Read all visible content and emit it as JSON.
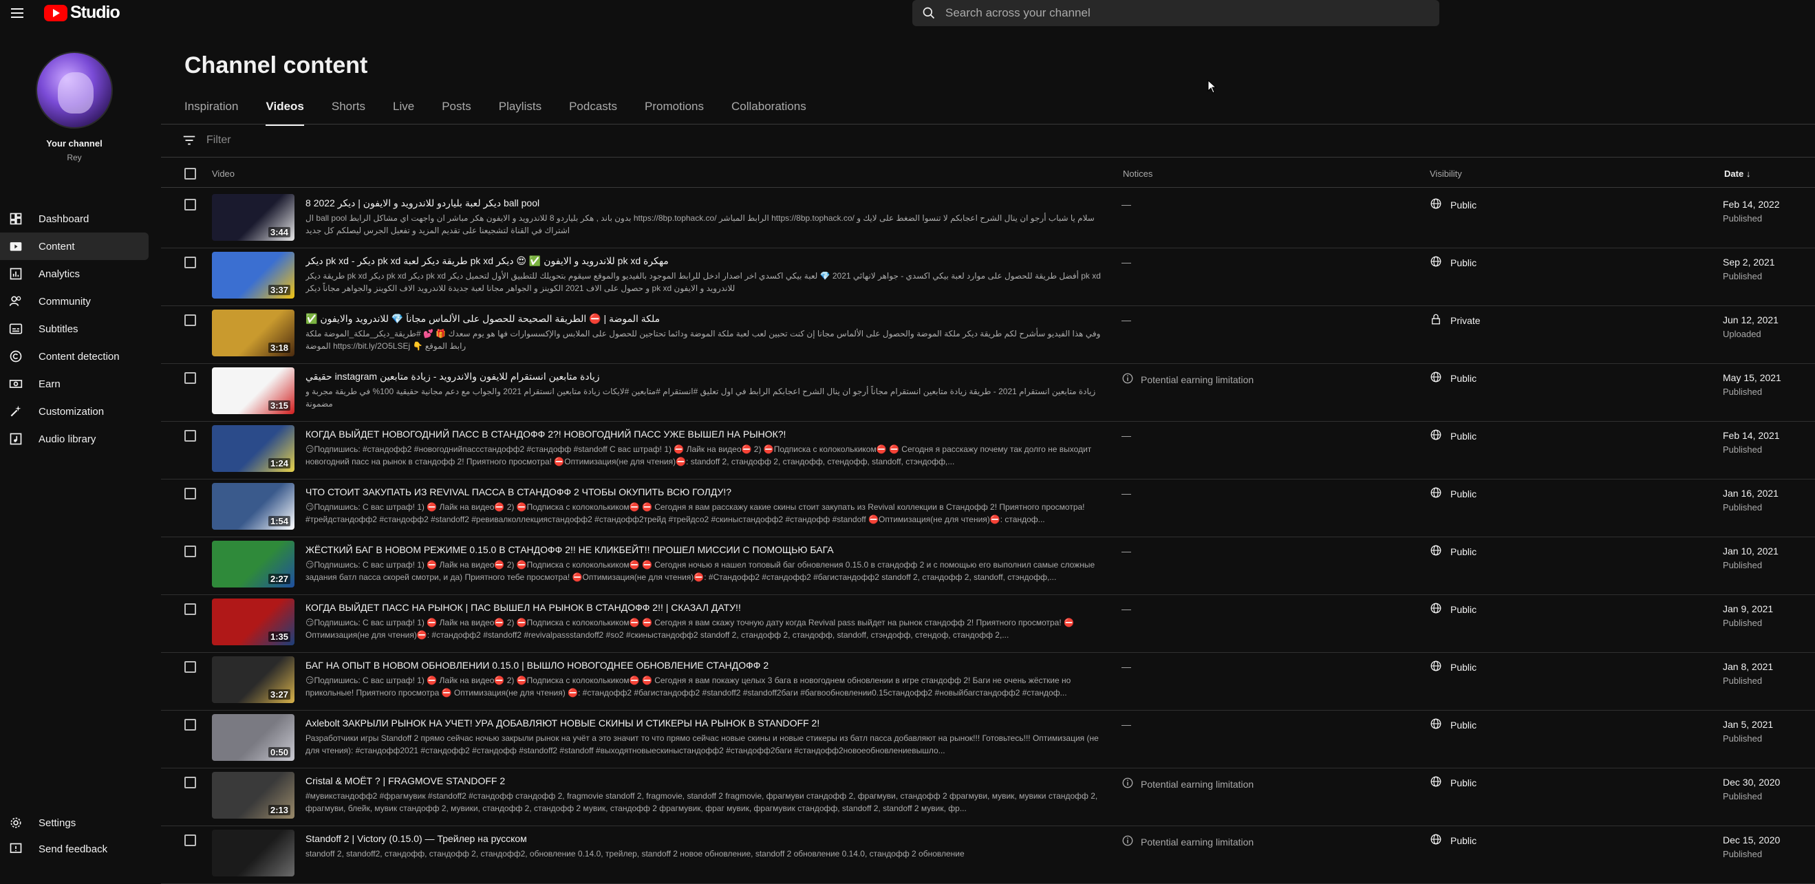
{
  "app": {
    "logo_text": "Studio",
    "search_placeholder": "Search across your channel"
  },
  "sidebar": {
    "channel_label": "Your channel",
    "channel_handle": "Rey",
    "items": [
      {
        "label": "Dashboard",
        "icon": "dashboard-icon"
      },
      {
        "label": "Content",
        "icon": "content-icon",
        "active": true
      },
      {
        "label": "Analytics",
        "icon": "analytics-icon"
      },
      {
        "label": "Community",
        "icon": "community-icon"
      },
      {
        "label": "Subtitles",
        "icon": "subtitles-icon"
      },
      {
        "label": "Content detection",
        "icon": "copyright-icon"
      },
      {
        "label": "Earn",
        "icon": "earn-icon"
      },
      {
        "label": "Customization",
        "icon": "customization-icon"
      },
      {
        "label": "Audio library",
        "icon": "audio-library-icon"
      }
    ],
    "bottom": [
      {
        "label": "Settings",
        "icon": "gear-icon"
      },
      {
        "label": "Send feedback",
        "icon": "feedback-icon"
      }
    ]
  },
  "main": {
    "title": "Channel content",
    "tabs": [
      "Inspiration",
      "Videos",
      "Shorts",
      "Live",
      "Posts",
      "Playlists",
      "Podcasts",
      "Promotions",
      "Collaborations"
    ],
    "active_tab": "Videos",
    "filter_placeholder": "Filter",
    "columns": {
      "video": "Video",
      "notices": "Notices",
      "visibility": "Visibility",
      "date": "Date"
    }
  },
  "colors": {
    "accent": "#ff0000",
    "background": "#0f0f0f",
    "surface": "#282828"
  },
  "videos": [
    {
      "title": "ديكر لعبة بلياردو للاندرويد و الايفون | ديكر 2022 8 ball pool",
      "desc": "ال ball pool بدون باند , هكر بلياردو 8 للاندرويد و الايفون هكر مباشر ان واجهت اي مشاكل الرابط https://8bp.tophack.co/ الرابط المباشر https://8bp.tophack.co/ سلام يا شباب أرجو ان ينال الشرح اعجابكم لا تنسوا الضغط على لايك و اشتراك في القناة لتشجيعنا على تقديم المزيد و تفعيل الجرس ليصلكم كل جديد",
      "duration": "3:44",
      "notice": "—",
      "notice_icon": false,
      "visibility": "Public",
      "vis_icon": "globe",
      "date": "Feb 14, 2022",
      "status": "Published",
      "thumb": [
        "#1a1a2e",
        "#e8e8e8"
      ]
    },
    {
      "title": "ديكر pk xd - ديكر pk xd طريقة ديكر لعبة pk xd للاندرويد و الايفون ✅ 😍 ديكر pk xd مهكرة",
      "desc": "طريقة ديكر pk xd ديكر pk xd ديكر pk xd أفضل طريقة للحصول على موارد لعبة بيكي اكسدي - جواهر لانهائي 2021 💎 لعبة بيكي اكسدي اخر اصدار ادخل للرابط الموجود بالفيديو والموقع سيقوم بتحويلك للتطبيق الأول لتحميل ديكر pk xd و حصول على الاف 2021 الكوينز و الجواهر مجانا لعبة جديدة للاندرويد الاف الكوينز والجواهر مجاناً ديكر pk xd للاندرويد و الايفون",
      "duration": "3:37",
      "notice": "—",
      "notice_icon": false,
      "visibility": "Public",
      "vis_icon": "globe",
      "date": "Sep 2, 2021",
      "status": "Published",
      "thumb": [
        "#3b6fd1",
        "#f2c311"
      ]
    },
    {
      "title": "✅ ملكة الموضة | ⛔ الطريقة الصحيحة للحصول على الألماس مجاناً 💎 للاندرويد والايفون",
      "desc": "وفي هذا الفيديو سأشرح لكم طريقة ديكر ملكة الموضة والحصول على الألماس مجانا إن كنت تحبين لعب لعبة ملكة الموضة ودائما تحتاجين للحصول على الملابس والإكسسوارات فها هو يوم سعدك 🎁 💕 #طريقة_ديكر_ملكة_الموضة ملكة الموضة https://bit.ly/2O5LSEj 👇 رابط الموقع",
      "duration": "3:18",
      "notice": "—",
      "notice_icon": false,
      "visibility": "Private",
      "vis_icon": "lock",
      "date": "Jun 12, 2021",
      "status": "Uploaded",
      "thumb": [
        "#c99a2e",
        "#4a2a0f"
      ]
    },
    {
      "title": "حقيقي instagram زيادة متابعين انستقرام للايفون والاندرويد - زيادة متابعين",
      "desc": "زيادة متابعين انستقرام 2021 - طريقة زيادة متابعين انستقرام مجاناً أرجو ان ينال الشرح اعجابكم الرابط في اول تعليق #انستقرام #متابعين #لايكات زيادة متابعين انستقرام 2021 والجواب مع دعم مجانية حقيقية 100% في طريقة مجربة و مضمونة",
      "duration": "3:15",
      "notice": "Potential earning limitation",
      "notice_icon": true,
      "visibility": "Public",
      "vis_icon": "globe",
      "date": "May 15, 2021",
      "status": "Published",
      "thumb": [
        "#f5f5f5",
        "#d01d1d"
      ]
    },
    {
      "title": "КОГДА ВЫЙДЕТ НОВОГОДНИЙ ПАСС В СТАНДОФФ 2?! НОВОГОДНИЙ ПАСС УЖЕ ВЫШЕЛ НА РЫНОК?!",
      "desc": "😏Подпишись: #стандофф2 #новогоднийпассстандофф2 #стандофф #standoff С вас штраф! 1) ⛔ Лайк на видео⛔ 2) ⛔Подписка с колоколькиком⛔ ⛔ Сегодня я расскажу почему так долго не выходит новогодний пасс на рынок в стандофф 2! Приятного просмотра! ⛔Оптимизация(не для чтения)⛔: standoff 2, стандофф 2, стандофф, стендофф, standoff, стэндофф,...",
      "duration": "1:24",
      "notice": "—",
      "notice_icon": false,
      "visibility": "Public",
      "vis_icon": "globe",
      "date": "Feb 14, 2021",
      "status": "Published",
      "thumb": [
        "#2b4b8a",
        "#e7d24a"
      ]
    },
    {
      "title": "ЧТО СТОИТ ЗАКУПАТЬ ИЗ REVIVAL ПАССА В СТАНДОФФ 2 ЧТОБЫ ОКУПИТЬ ВСЮ ГОЛДУ!?",
      "desc": "😏Подпишись: С вас штраф! 1) ⛔ Лайк на видео⛔ 2) ⛔Подписка с колоколькиком⛔ ⛔ Сегодня я вам расскажу какие скины стоит закупать из Revival коллекции в Стандофф 2! Приятного просмотра! #трейдстандофф2 #стандофф2 #standoff2 #ревивалколлекциястандофф2 #стандофф2трейд #трейдсо2 #скиныстандофф2 #стандофф #standoff ⛔Оптимизация(не для чтения)⛔: стандоф...",
      "duration": "1:54",
      "notice": "—",
      "notice_icon": false,
      "visibility": "Public",
      "vis_icon": "globe",
      "date": "Jan 16, 2021",
      "status": "Published",
      "thumb": [
        "#3a5a8c",
        "#ffffff"
      ]
    },
    {
      "title": "ЖЁСТКИЙ БАГ В НОВОМ РЕЖИМЕ 0.15.0 В СТАНДОФФ 2!! НЕ КЛИКБЕЙТ!! ПРОШЕЛ МИССИИ С ПОМОЩЬЮ БАГА",
      "desc": "😏Подпишись: С вас штраф! 1) ⛔ Лайк на видео⛔ 2) ⛔Подписка с колоколькиком⛔ ⛔ Сегодня ночью я нашел топовый баг обновления 0.15.0 в стандофф 2 и с помощью его выполнил самые сложные задания батл пасса скорей смотри, и да) Приятного тебе просмотра! ⛔Оптимизация(не для чтения)⛔: #Стандофф2 #стандофф2 #багистандофф2 standoff 2, стандофф 2, standoff, стэндофф,...",
      "duration": "2:27",
      "notice": "—",
      "notice_icon": false,
      "visibility": "Public",
      "vis_icon": "globe",
      "date": "Jan 10, 2021",
      "status": "Published",
      "thumb": [
        "#2f8a3a",
        "#1f4fa0"
      ]
    },
    {
      "title": "КОГДА ВЫЙДЕТ ПАСС НА РЫНОК | ПАС ВЫШЕЛ НА РЫНОК В СТАНДОФФ 2!! | СКАЗАЛ ДАТУ!!",
      "desc": "😏Подпишись: С вас штраф! 1) ⛔ Лайк на видео⛔ 2) ⛔Подписка с колоколькиком⛔ ⛔ Сегодня я вам скажу точную дату когда Revival pass выйдет на рынок стандофф 2! Приятного просмотра! ⛔Оптимизация(не для чтения)⛔: #стандофф2 #standoff2 #revivalpassstandoff2 #so2 #скиныстандофф2 standoff 2, стандофф 2, стандофф, standoff, стэндофф, стендоф, стандофф 2,...",
      "duration": "1:35",
      "notice": "—",
      "notice_icon": false,
      "visibility": "Public",
      "vis_icon": "globe",
      "date": "Jan 9, 2021",
      "status": "Published",
      "thumb": [
        "#b01818",
        "#1b3f7a"
      ]
    },
    {
      "title": "БАГ НА ОПЫТ В НОВОМ ОБНОВЛЕНИИ 0.15.0 | ВЫШЛО НОВОГОДНЕЕ ОБНОВЛЕНИЕ СТАНДОФФ 2",
      "desc": "😏Подпишись: С вас штраф! 1) ⛔ Лайк на видео⛔ 2) ⛔Подписка с колоколькиком⛔ ⛔ Сегодня я вам покажу целых 3 бага в новогоднем обновлении в игре стандофф 2! Баги не очень жёсткие но прикольные! Приятного просмотра ⛔ Оптимизация(не для чтения) ⛔: #стандофф2 #багистандофф2 #standoff2 #standoff2баги #багвообновлении0.15стандофф2 #новыйбагстандофф2 #стандоф...",
      "duration": "3:27",
      "notice": "—",
      "notice_icon": false,
      "visibility": "Public",
      "vis_icon": "globe",
      "date": "Jan 8, 2021",
      "status": "Published",
      "thumb": [
        "#2a2a2a",
        "#d8b24a"
      ]
    },
    {
      "title": "Axlebolt ЗАКРЫЛИ РЫНОК НА УЧЕТ! УРА ДОБАВЛЯЮТ НОВЫЕ СКИНЫ И СТИКЕРЫ НА РЫНОК В STANDOFF 2!",
      "desc": "Разработчики игры Standoff 2 прямо сейчас ночью закрыли рынок на учёт а это значит то что прямо сейчас новые скины и новые стикеры из батл пасса добавляют на рынок!!! Готовьтесь!!! Оптимизация (не для чтения): #стандофф2021 #стандофф2 #стандофф #standoff2 #standoff #выходятновыескиныстандофф2 #стандофф2баги #стандофф2новоеобновлениевышло...",
      "duration": "0:50",
      "notice": "—",
      "notice_icon": false,
      "visibility": "Public",
      "vis_icon": "globe",
      "date": "Jan 5, 2021",
      "status": "Published",
      "thumb": [
        "#7a7a82",
        "#c9c9d1"
      ]
    },
    {
      "title": "Cristal & MOЁT ? | FRAGMOVE STANDOFF 2",
      "desc": "#мувикстандофф2 #фрагмувик #standoff2 #стандофф стандофф 2, fragmovie standoff 2, fragmovie, standoff 2 fragmovie, фрагмуви стандофф 2, фрагмуви, стандофф 2 фрагмуви, мувик, мувики стандофф 2, фрагмуви, блейк, мувик стандофф 2, мувики, стандофф 2, стандофф 2 мувик, стандофф 2 фрагмувик, фраг мувик, фрагмувик стандофф, standoff 2, standoff 2 мувик, фр...",
      "duration": "2:13",
      "notice": "Potential earning limitation",
      "notice_icon": true,
      "visibility": "Public",
      "vis_icon": "globe",
      "date": "Dec 30, 2020",
      "status": "Published",
      "thumb": [
        "#3a3a3a",
        "#9a8a6a"
      ]
    },
    {
      "title": "Standoff 2 | Victory (0.15.0) — Трейлер на русском",
      "desc": "standoff 2, standoff2, стандофф, стандофф 2, стандофф2, обновление 0.14.0, трейлер, standoff 2 новое обновление, standoff 2 обновление 0.14.0, стандофф 2 обновление",
      "duration": "",
      "notice": "Potential earning limitation",
      "notice_icon": true,
      "visibility": "Public",
      "vis_icon": "globe",
      "date": "Dec 15, 2020",
      "status": "Published",
      "thumb": [
        "#1b1b1b",
        "#6b6b6b"
      ]
    }
  ]
}
